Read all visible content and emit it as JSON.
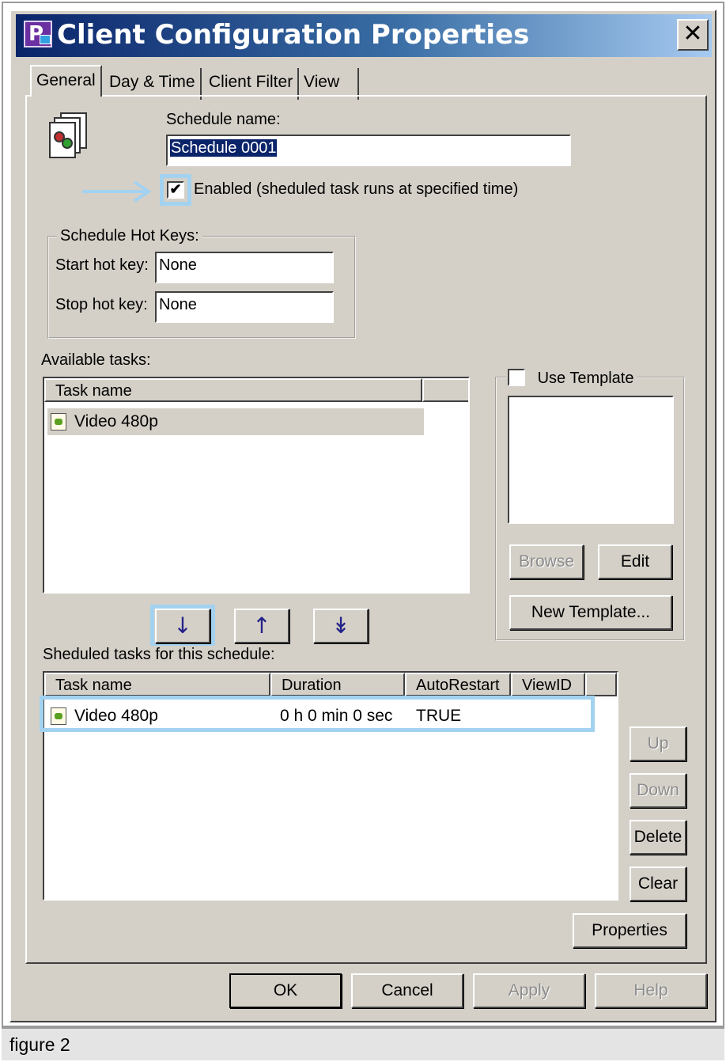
{
  "window": {
    "title": "Client Configuration Properties",
    "close_glyph": "✕"
  },
  "tabs": [
    {
      "label": "General",
      "active": true
    },
    {
      "label": "Day & Time",
      "active": false
    },
    {
      "label": "Client Filter",
      "active": false
    },
    {
      "label": "View",
      "active": false
    }
  ],
  "general": {
    "schedule_name_label": "Schedule name:",
    "schedule_name_value": "Schedule 0001",
    "enabled_label": "Enabled (sheduled task runs at specified time)",
    "enabled_checked": true,
    "check_glyph": "✔",
    "hotkeys": {
      "group_label": "Schedule Hot Keys:",
      "start_label": "Start hot key:",
      "start_value": "None",
      "stop_label": "Stop hot key:",
      "stop_value": "None"
    },
    "available": {
      "label": "Available tasks:",
      "column_header": "Task name",
      "rows": [
        {
          "name": "Video 480p"
        }
      ]
    },
    "template": {
      "label": "Use Template",
      "checked": false,
      "browse_label": "Browse",
      "edit_label": "Edit",
      "new_template_label": "New Template..."
    },
    "transfer_buttons": {
      "add_glyph": "↓",
      "remove_glyph": "↑",
      "add_all_glyph": "↡"
    },
    "scheduled": {
      "label": "Sheduled tasks for this schedule:",
      "columns": [
        "Task name",
        "Duration",
        "AutoRestart",
        "ViewID"
      ],
      "rows": [
        {
          "name": "Video 480p",
          "duration": "0 h 0 min 0 sec",
          "autorestart": "TRUE",
          "viewid": ""
        }
      ]
    },
    "side_buttons": {
      "up_label": "Up",
      "down_label": "Down",
      "delete_label": "Delete",
      "clear_label": "Clear",
      "properties_label": "Properties"
    }
  },
  "footer_buttons": {
    "ok_label": "OK",
    "cancel_label": "Cancel",
    "apply_label": "Apply",
    "help_label": "Help"
  },
  "caption": "figure 2",
  "colors": {
    "annotation_highlight": "#a3d2f0",
    "titlebar_start": "#0a246a",
    "titlebar_end": "#a6caf0",
    "dialog_face": "#d4d0c8"
  }
}
